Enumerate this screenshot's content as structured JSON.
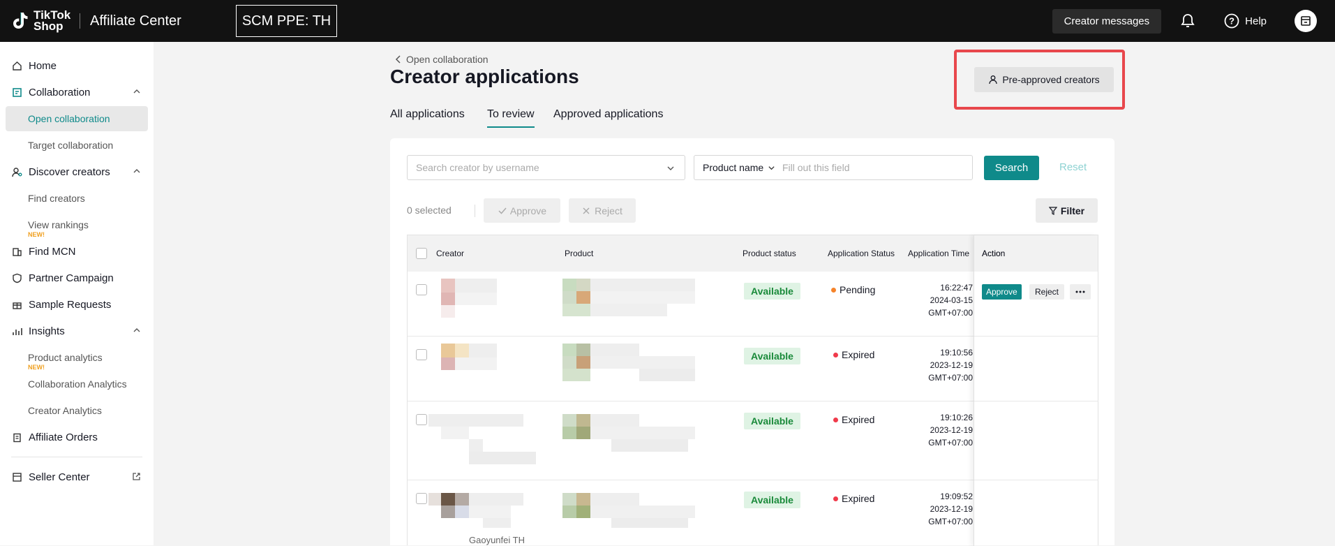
{
  "topbar": {
    "logo_text": "TikTok Shop",
    "app_title": "Affiliate Center",
    "env_badge": "SCM PPE: TH",
    "creator_messages": "Creator messages",
    "help": "Help"
  },
  "sidebar": {
    "home": "Home",
    "collaboration": "Collaboration",
    "open_collaboration": "Open collaboration",
    "target_collaboration": "Target collaboration",
    "discover_creators": "Discover creators",
    "find_creators": "Find creators",
    "view_rankings": "View rankings",
    "new_tag": "NEW!",
    "find_mcn": "Find MCN",
    "partner_campaign": "Partner Campaign",
    "sample_requests": "Sample Requests",
    "insights": "Insights",
    "product_analytics": "Product analytics",
    "collaboration_analytics": "Collaboration Analytics",
    "creator_analytics": "Creator Analytics",
    "affiliate_orders": "Affiliate Orders",
    "seller_center": "Seller Center"
  },
  "page": {
    "breadcrumb": "Open collaboration",
    "title": "Creator applications",
    "preapproved_button": "Pre-approved creators",
    "tabs": [
      "All applications",
      "To review",
      "Approved applications"
    ],
    "active_tab": "To review"
  },
  "search": {
    "creator_placeholder": "Search creator by username",
    "product_select": "Product name",
    "product_placeholder": "Fill out this field",
    "search_button": "Search",
    "reset_button": "Reset"
  },
  "toolbar": {
    "selected": "0 selected",
    "approve": "Approve",
    "reject": "Reject",
    "filter": "Filter"
  },
  "table": {
    "headers": {
      "creator": "Creator",
      "product": "Product",
      "product_status": "Product status",
      "application_status": "Application Status",
      "application_time": "Application Time",
      "action": "Action"
    },
    "rows": [
      {
        "product_status": "Available",
        "app_status": "Pending",
        "status_color": "#f5832a",
        "time": "16:22:47",
        "date": "2024-03-15",
        "tz": "GMT+07:00",
        "actions": true
      },
      {
        "product_status": "Available",
        "app_status": "Expired",
        "status_color": "#f03a4b",
        "time": "19:10:56",
        "date": "2023-12-19",
        "tz": "GMT+07:00",
        "actions": false
      },
      {
        "product_status": "Available",
        "app_status": "Expired",
        "status_color": "#f03a4b",
        "time": "19:10:26",
        "date": "2023-12-19",
        "tz": "GMT+07:00",
        "actions": false
      },
      {
        "product_status": "Available",
        "app_status": "Expired",
        "status_color": "#f03a4b",
        "time": "19:09:52",
        "date": "2023-12-19",
        "tz": "GMT+07:00",
        "actions": false,
        "creator_name": "Gaoyunfei TH"
      }
    ],
    "row_actions": {
      "approve": "Approve",
      "reject": "Reject"
    }
  },
  "colors": {
    "accent": "#0f8a8a",
    "highlight": "#e8474c",
    "topbar": "#121212"
  }
}
